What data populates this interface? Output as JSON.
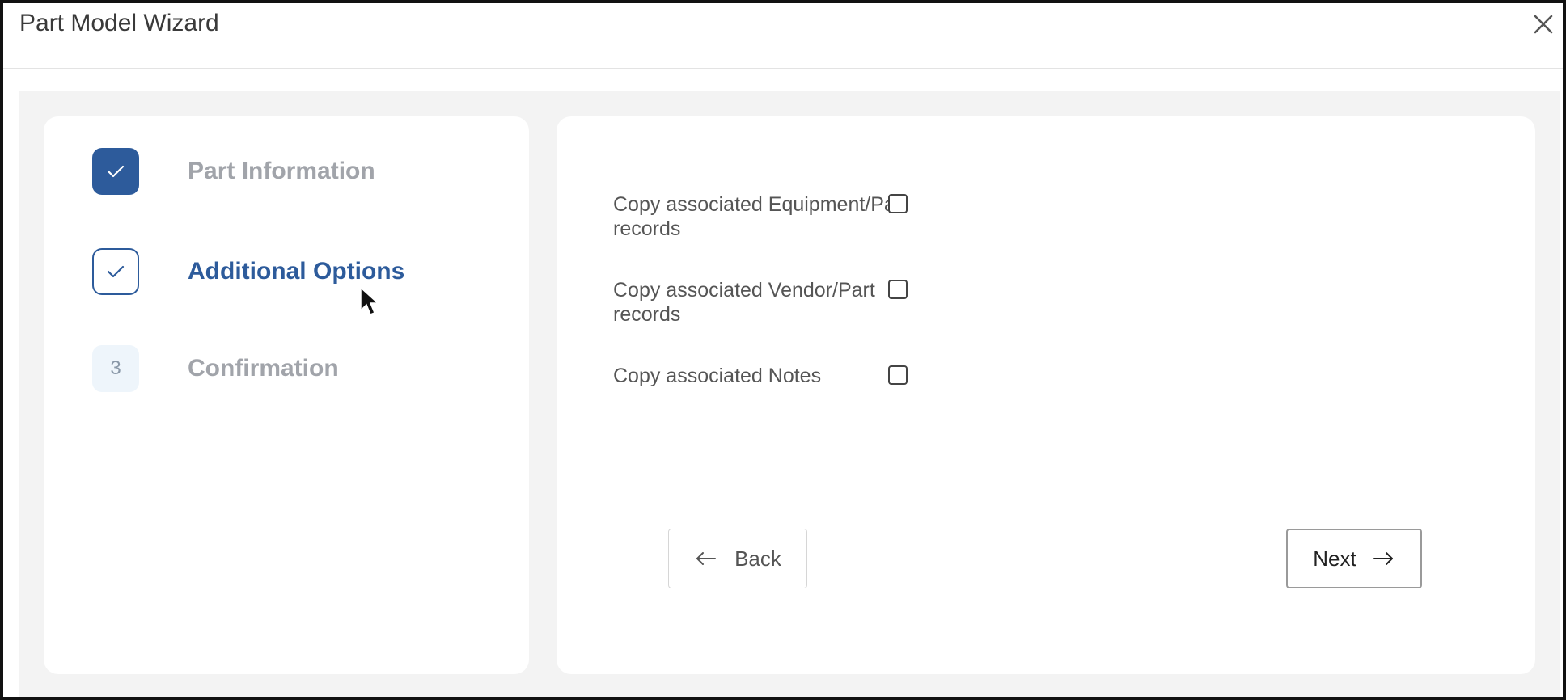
{
  "window": {
    "title": "Part Model Wizard",
    "close_icon": "close-icon"
  },
  "steps": [
    {
      "label": "Part Information",
      "status": "completed",
      "icon": "check-icon"
    },
    {
      "label": "Additional Options",
      "status": "current",
      "icon": "check-icon"
    },
    {
      "label": "Confirmation",
      "status": "pending",
      "number": "3"
    }
  ],
  "options": [
    {
      "label": "Copy associated Equipment/Part records",
      "checked": false
    },
    {
      "label": "Copy associated Vendor/Part records",
      "checked": false
    },
    {
      "label": "Copy associated Notes",
      "checked": false
    }
  ],
  "buttons": {
    "back_label": "Back",
    "back_icon": "arrow-left-icon",
    "next_label": "Next",
    "next_icon": "arrow-right-icon"
  },
  "colors": {
    "accent": "#2d5b9b",
    "muted_text": "#a1a4aa",
    "background": "#f3f3f3"
  }
}
